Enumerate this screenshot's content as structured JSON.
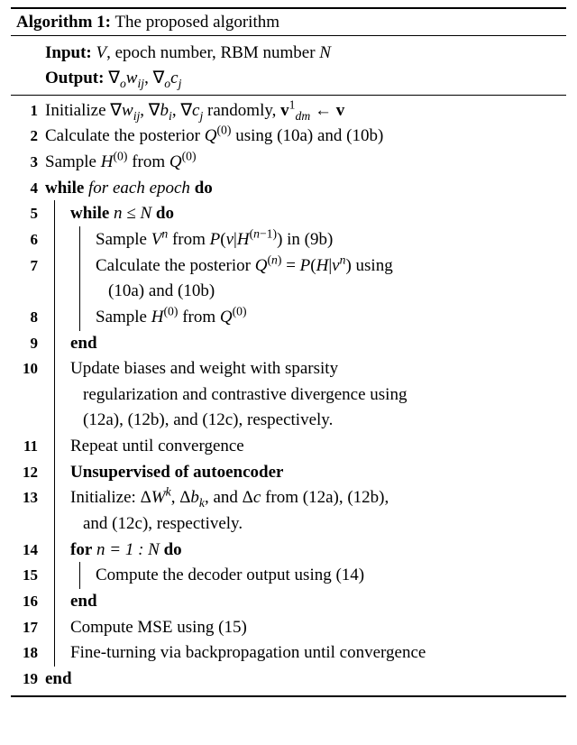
{
  "title_label": "Algorithm 1:",
  "title_text": "The proposed algorithm",
  "input_label": "Input:",
  "input_text_html": "<span class='math'><i>V</i></span>, epoch number, RBM number <span class='math'><i>N</i></span>",
  "output_label": "Output:",
  "output_text_html": "<span class='math'>∇<sub><i>o</i></sub><i>w</i><sub><i>ij</i></sub>, ∇<sub><i>o</i></sub><i>c</i><sub><i>j</i></sub></span>",
  "lines": {
    "l1": "Initialize <span class='math'>∇<i>w</i><sub><i>ij</i></sub>, ∇<i>b</i><sub><i>i</i></sub>, ∇<i>c</i><sub><i>j</i></sub></span> randomly, <span class='math'><b>v</b><sup>1</sup><sub><i>dm</i></sub> ← <b>v</b></span>",
    "l2": "Calculate the posterior <span class='math'><i>Q</i><sup>(0)</sup></span> using (10a) and (10b)",
    "l3": "Sample <span class='math'><i>H</i><sup>(0)</sup></span> from <span class='math'><i>Q</i><sup>(0)</sup></span>",
    "l4a": "while",
    "l4b": "for each epoch",
    "l4c": "do",
    "l5a": "while",
    "l5b_html": "<span class='math'><i>n</i> ≤ <i>N</i></span>",
    "l5c": "do",
    "l6": "Sample <span class='math'><i>V</i><sup><i>n</i></sup></span> from <span class='math'><i>P</i>(<i>v</i>|<i>H</i><sup>(<i>n</i>−1)</sup>)</span> in (9b)",
    "l7a": "Calculate the posterior <span class='math'><i>Q</i><sup>(<i>n</i>)</sup> = <i>P</i>(<i>H</i>|<i>v</i><sup><i>n</i></sup>)</span> using",
    "l7b": "(10a) and (10b)",
    "l8": "Sample <span class='math'><i>H</i><sup>(0)</sup></span> from <span class='math'><i>Q</i><sup>(0)</sup></span>",
    "l9": "end",
    "l10a": "Update biases and weight with sparsity",
    "l10b": "regularization and contrastive divergence using",
    "l10c": "(12a), (12b), and (12c), respectively.",
    "l11": "Repeat until convergence",
    "l12": "Unsupervised of autoencoder",
    "l13a": "Initialize: <span class='math'>Δ<i>W</i><sup><i>k</i></sup>, Δ<i>b</i><sub><i>k</i></sub></span>, and <span class='math'>Δ<i>c</i></span> from (12a), (12b),",
    "l13b": "and (12c), respectively.",
    "l14a": "for",
    "l14b_html": "<span class='math'><i>n</i> = 1 : <i>N</i></span>",
    "l14c": "do",
    "l15": "Compute the decoder output using (14)",
    "l16": "end",
    "l17": "Compute MSE using (15)",
    "l18": "Fine-turning via backpropagation until convergence",
    "l19": "end"
  }
}
